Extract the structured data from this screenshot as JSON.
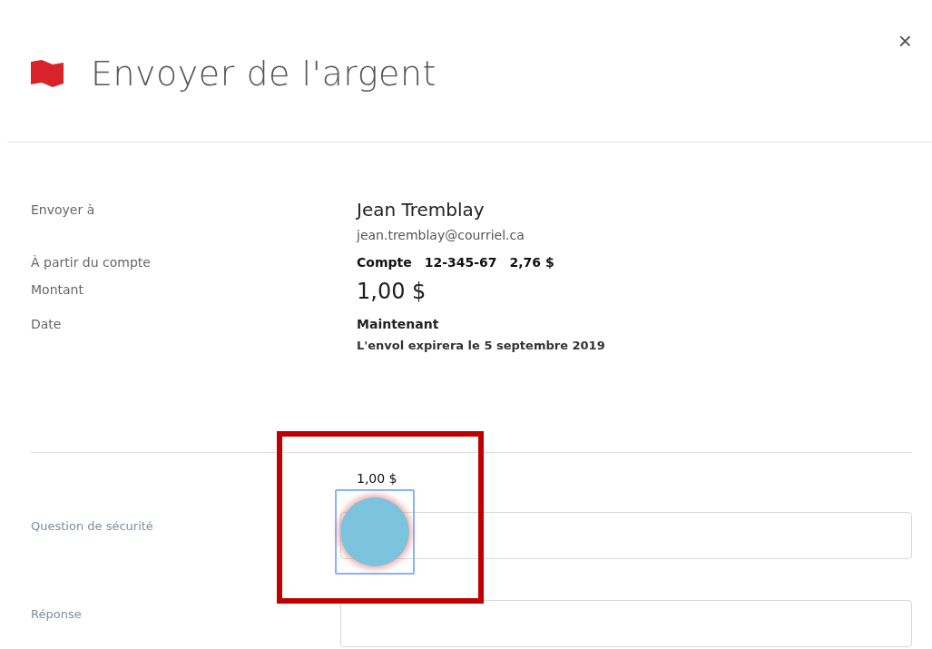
{
  "dialog": {
    "title": "Envoyer de l'argent",
    "close": "×"
  },
  "summary": [
    {
      "label": "Envoyer à",
      "kind": "recipient",
      "value": "Jean Tremblay",
      "detail": "jean.tremblay@courriel.ca"
    },
    {
      "label": "À partir du compte",
      "kind": "account",
      "parts": [
        "Compte",
        "12-345-67",
        "2,76 $"
      ]
    },
    {
      "label": "Montant",
      "kind": "amount",
      "value": "1,00 $"
    },
    {
      "label": "Date",
      "kind": "date",
      "value": "Maintenant",
      "detail": "L'envol expirera le 5 septembre 2019"
    }
  ],
  "amount_note": "1,00 $",
  "fields": [
    {
      "label": "Question de sécurité"
    },
    {
      "label": "Réponse"
    }
  ],
  "tap_indicator": {
    "framed": true
  }
}
